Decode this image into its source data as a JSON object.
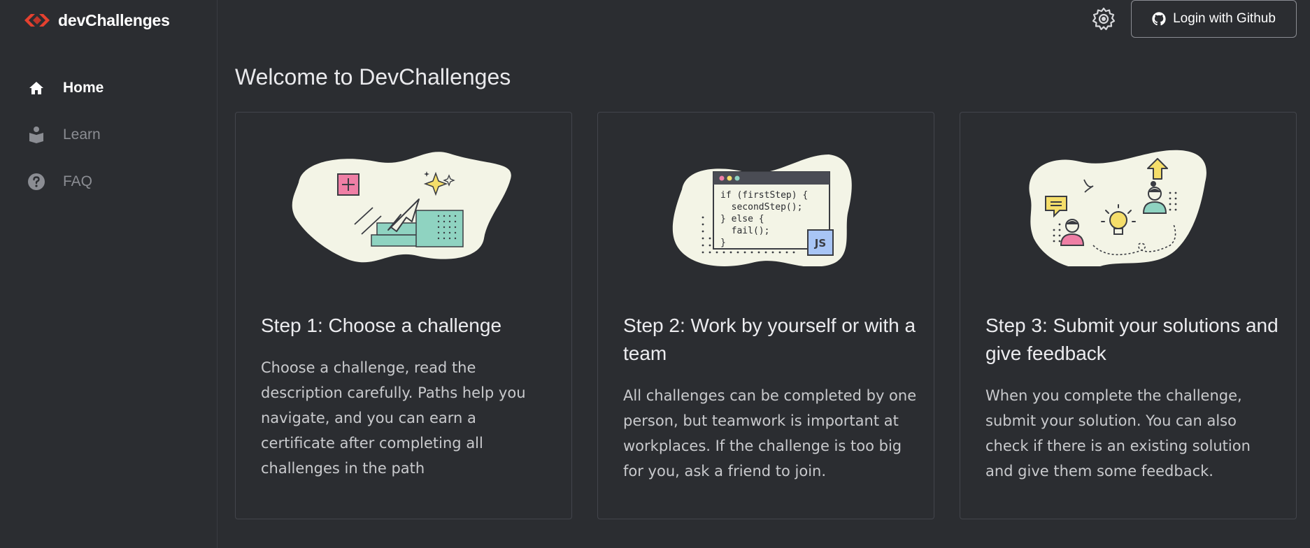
{
  "brand": {
    "name": "devChallenges"
  },
  "nav": {
    "items": [
      {
        "label": "Home",
        "icon": "home-icon",
        "active": true
      },
      {
        "label": "Learn",
        "icon": "book-reader-icon",
        "active": false
      },
      {
        "label": "FAQ",
        "icon": "question-circle-icon",
        "active": false
      }
    ]
  },
  "topbar": {
    "theme_icon": "sun-gear-icon",
    "login_label": "Login with Github",
    "login_icon": "github-icon"
  },
  "main": {
    "title": "Welcome to DevChallenges",
    "cards": [
      {
        "title": "Step 1: Choose a challenge",
        "description": "Choose a challenge, read the description carefully. Paths help you navigate, and you can earn a certificate after completing all challenges in the path",
        "illustration": "cursor-blocks-illustration"
      },
      {
        "title": "Step 2: Work by yourself or with a team",
        "description": "All challenges can be completed by one person, but teamwork is important at workplaces. If the challenge is too big for you, ask a friend to join.",
        "illustration": "code-window-illustration",
        "code_lines": [
          "if (firstStep) {",
          "  secondStep();",
          "} else {",
          "  fail();",
          "}"
        ],
        "badge": "JS"
      },
      {
        "title": "Step 3: Submit your solutions and give feedback",
        "description": "When you complete the challenge, submit your solution. You can also check if there is an existing solution and give them some feedback.",
        "illustration": "team-idea-illustration"
      }
    ]
  },
  "colors": {
    "background": "#2b2d31",
    "brand_red": "#e5412f",
    "blob": "#f3f4e6",
    "teal": "#8fd3c1",
    "pink": "#ef7fa5",
    "yellow": "#f5de6a",
    "blue": "#a8c5f5"
  }
}
